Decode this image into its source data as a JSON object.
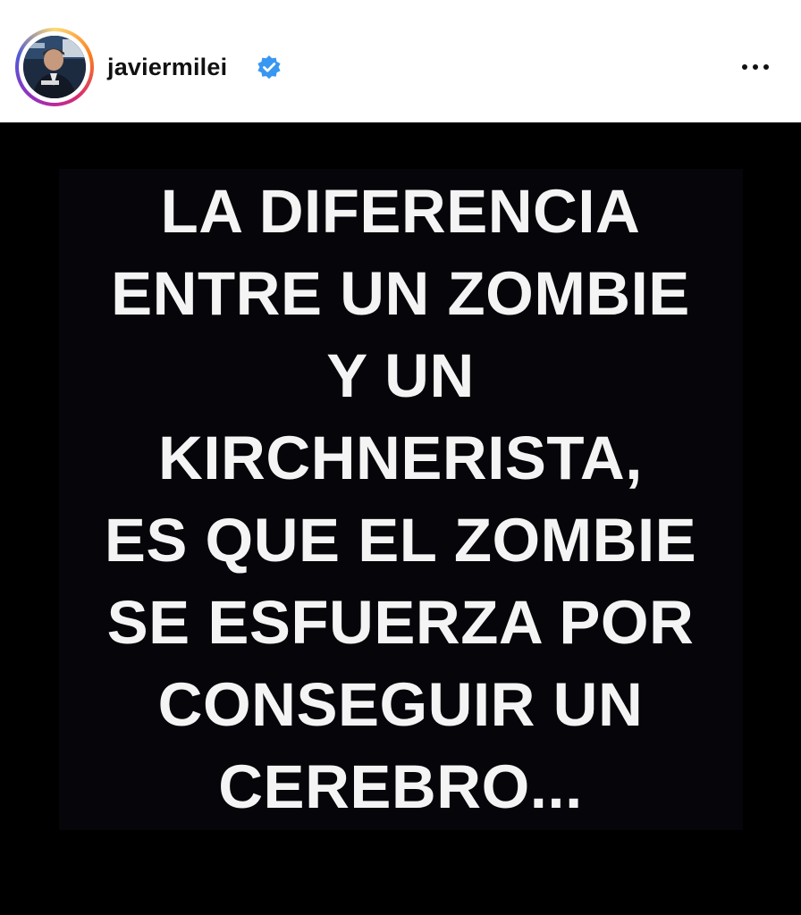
{
  "post": {
    "username": "javiermilei",
    "verified": true,
    "more_options_label": "more-options"
  },
  "icons": {
    "verified": "verified-badge-icon",
    "more": "more-options-icon",
    "avatar": "profile-photo"
  },
  "colors": {
    "verified_blue": "#3897f0",
    "image_background": "#000000",
    "text": "#f4f4f4"
  },
  "meme": {
    "lines": [
      "LA DIFERENCIA",
      "ENTRE UN ZOMBIE",
      "Y UN",
      "KIRCHNERISTA,",
      "ES QUE EL ZOMBIE",
      "SE ESFUERZA POR",
      "CONSEGUIR UN",
      "CEREBRO..."
    ]
  }
}
